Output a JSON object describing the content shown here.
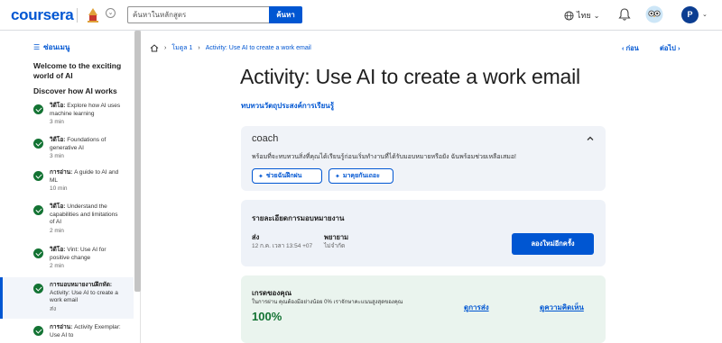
{
  "header": {
    "logo": "coursera",
    "search_placeholder": "ค้นหาในหลักสูตร",
    "search_button": "ค้นหา",
    "language": "ไทย",
    "avatar_initial": "P"
  },
  "sidebar": {
    "menu_label": "ซ่อนเมนู",
    "module_title": "Welcome to the exciting world of AI",
    "section_title": "Discover how AI works",
    "items": [
      {
        "type": "วิดีโอ:",
        "title": "Explore how AI uses machine learning",
        "duration": "3 min"
      },
      {
        "type": "วิดีโอ:",
        "title": "Foundations of generative AI",
        "duration": "3 min"
      },
      {
        "type": "การอ่าน:",
        "title": "A guide to AI and ML",
        "duration": "10 min"
      },
      {
        "type": "วิดีโอ:",
        "title": "Understand the capabilities and limitations of AI",
        "duration": "2 min"
      },
      {
        "type": "วิดีโอ:",
        "title": "Vint: Use AI for positive change",
        "duration": "2 min"
      },
      {
        "type": "การมอบหมายงานฝึกหัด:",
        "title": "Activity: Use AI to create a work email",
        "duration": "ส่ง"
      },
      {
        "type": "การอ่าน:",
        "title": "Activity Exemplar: Use AI to",
        "duration": ""
      }
    ]
  },
  "breadcrumb": {
    "module": "โมดูล 1",
    "current": "Activity: Use AI to create a work email"
  },
  "nav": {
    "prev": "ก่อน",
    "next": "ต่อไป"
  },
  "main": {
    "title": "Activity: Use AI to create a work email",
    "review_link": "ทบทวนวัตถุประสงค์การเรียนรู้"
  },
  "coach": {
    "title": "coach",
    "description": "พร้อมที่จะทบทวนสิ่งที่คุณได้เรียนรู้ก่อนเริ่มทำงานที่ได้รับมอบหมายหรือยัง ฉันพร้อมช่วยเหลือเสมอ!",
    "button1": "ช่วยฉันฝึกฝน",
    "button2": "มาคุยกันเถอะ"
  },
  "assignment": {
    "title": "รายละเอียดการมอบหมายงาน",
    "submitted_label": "ส่ง",
    "submitted_value": "12 ก.ค. เวลา 13:54 +07",
    "attempts_label": "พยายาม",
    "attempts_value": "ไม่จำกัด",
    "retry_button": "ลองใหม่อีกครั้ง"
  },
  "grade": {
    "title": "เกรดของคุณ",
    "note": "ในการผ่าน คุณต้องมีอย่างน้อย 0% เราจักษาคะแนนสูงสุดของคุณ",
    "value": "100%",
    "view_submission": "ดูการส่ง",
    "view_feedback": "ดูความคิดเห็น"
  },
  "colors": {
    "brand_blue": "#0056d2",
    "success_green": "#137333",
    "coach_bg": "#f0f3f8",
    "grade_bg": "#eaf4ee"
  }
}
